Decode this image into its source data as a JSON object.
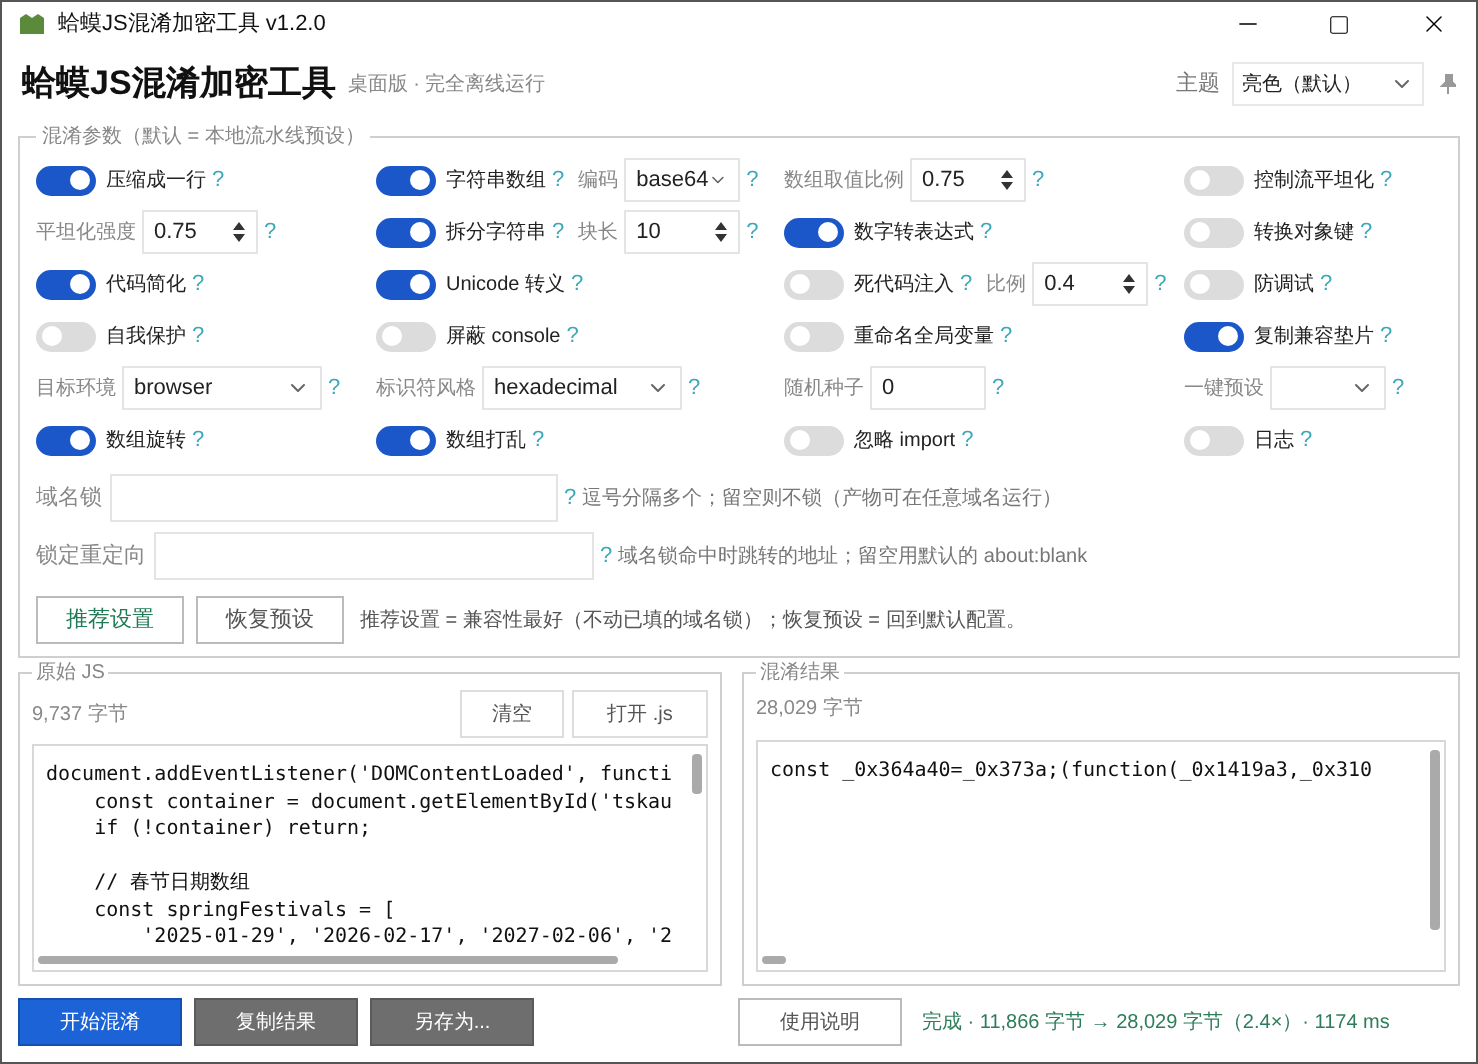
{
  "window": {
    "title": "蛤蟆JS混淆加密工具 v1.2.0"
  },
  "header": {
    "title": "蛤蟆JS混淆加密工具",
    "subtitle": "桌面版 · 完全离线运行",
    "theme_label": "主题",
    "theme_value": "亮色（默认）"
  },
  "options": {
    "legend": "混淆参数（默认 = 本地流水线预设）",
    "rows": [
      [
        [
          {
            "kind": "toggle",
            "label": "压缩成一行",
            "on": true,
            "help": "?"
          }
        ],
        [
          {
            "kind": "toggle",
            "label": "字符串数组",
            "on": true,
            "help": "?"
          },
          {
            "kind": "select",
            "label": "编码",
            "value": "base64",
            "help": "?"
          }
        ],
        [
          {
            "kind": "number",
            "label": "数组取值比例",
            "value": "0.75",
            "help": "?"
          }
        ],
        [
          {
            "kind": "toggle",
            "label": "控制流平坦化",
            "on": false,
            "help": "?"
          }
        ]
      ],
      [
        [
          {
            "kind": "number",
            "label": "平坦化强度",
            "value": "0.75",
            "help": "?"
          }
        ],
        [
          {
            "kind": "toggle",
            "label": "拆分字符串",
            "on": true,
            "help": "?"
          },
          {
            "kind": "number",
            "label": "块长",
            "value": "10",
            "help": "?"
          }
        ],
        [
          {
            "kind": "toggle",
            "label": "数字转表达式",
            "on": true,
            "help": "?"
          }
        ],
        [
          {
            "kind": "toggle",
            "label": "转换对象键",
            "on": false,
            "help": "?"
          }
        ]
      ],
      [
        [
          {
            "kind": "toggle",
            "label": "代码简化",
            "on": true,
            "help": "?"
          }
        ],
        [
          {
            "kind": "toggle",
            "label": "Unicode 转义",
            "on": true,
            "help": "?"
          }
        ],
        [
          {
            "kind": "toggle",
            "label": "死代码注入",
            "on": false,
            "help": "?"
          },
          {
            "kind": "number",
            "label": "比例",
            "value": "0.4",
            "help": "?"
          }
        ],
        [
          {
            "kind": "toggle",
            "label": "防调试",
            "on": false,
            "help": "?"
          }
        ]
      ],
      [
        [
          {
            "kind": "toggle",
            "label": "自我保护",
            "on": false,
            "help": "?"
          }
        ],
        [
          {
            "kind": "toggle",
            "label": "屏蔽 console",
            "on": false,
            "help": "?"
          }
        ],
        [
          {
            "kind": "toggle",
            "label": "重命名全局变量",
            "on": false,
            "help": "?"
          }
        ],
        [
          {
            "kind": "toggle",
            "label": "复制兼容垫片",
            "on": true,
            "help": "?"
          }
        ]
      ],
      [
        [
          {
            "kind": "select",
            "label": "目标环境",
            "value": "browser",
            "help": "?"
          }
        ],
        [
          {
            "kind": "select",
            "label": "标识符风格",
            "value": "hexadecimal",
            "help": "?"
          }
        ],
        [
          {
            "kind": "text",
            "label": "随机种子",
            "value": "0",
            "help": "?"
          }
        ],
        [
          {
            "kind": "select",
            "label": "一键预设",
            "help": "?"
          }
        ]
      ],
      [
        [
          {
            "kind": "toggle",
            "label": "数组旋转",
            "on": true,
            "help": "?"
          }
        ],
        [
          {
            "kind": "toggle",
            "label": "数组打乱",
            "on": true,
            "help": "?"
          }
        ],
        [
          {
            "kind": "toggle",
            "label": "忽略 import",
            "on": false,
            "help": "?"
          }
        ],
        [
          {
            "kind": "toggle",
            "label": "日志",
            "on": false,
            "help": "?"
          }
        ]
      ]
    ],
    "fields": [
      {
        "label": "域名锁",
        "help": "?",
        "note": "逗号分隔多个；留空则不锁（产物可在任意域名运行）"
      },
      {
        "label": "锁定重定向",
        "help": "?",
        "note": "域名锁命中时跳转的地址；留空用默认的 about:blank"
      }
    ],
    "buttons": [
      {
        "label": "推荐设置",
        "kind": "primary"
      },
      {
        "label": "恢复预设",
        "kind": "plain"
      }
    ],
    "buttons_note": "推荐设置 = 兼容性最好（不动已填的域名锁）；恢复预设 = 回到默认配置。"
  },
  "source": {
    "legend": "原始 JS",
    "size": "9,737 字节",
    "buttons": [
      "清空",
      "打开 .js"
    ],
    "code": [
      [
        "document.addEventListener('DOMContentLoaded', functi",
        "    const container = document.getElementById('tskau",
        "    if (!container) return;"
      ],
      [
        "    // 春节日期数组",
        "    const springFestivals = [",
        "        '2025-01-29', '2026-02-17', '2027-02-06', '2"
      ]
    ]
  },
  "result": {
    "legend": "混淆结果",
    "size": "28,029 字节",
    "code": [
      [
        "const _0x364a40=_0x373a;(function(_0x1419a3,_0x310"
      ]
    ]
  },
  "bottom": {
    "buttons": [
      {
        "label": "开始混淆",
        "kind": "blue"
      },
      {
        "label": "复制结果",
        "kind": "gray"
      },
      {
        "label": "另存为...",
        "kind": "gray"
      },
      {
        "label": "使用说明",
        "kind": "plain"
      }
    ],
    "status": "完成 · 11,866 字节 → 28,029 字节（2.4×）· 1174 ms"
  }
}
